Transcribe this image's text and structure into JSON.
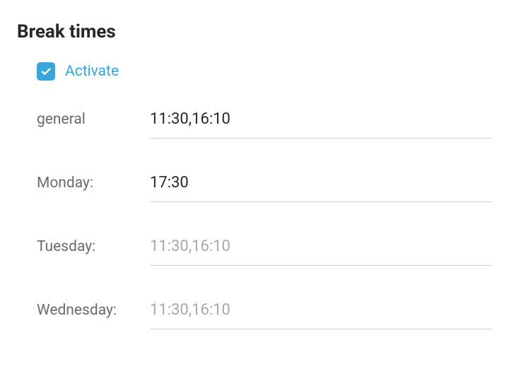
{
  "section": {
    "title": "Break times"
  },
  "activate": {
    "label": "Activate",
    "checked": true
  },
  "fields": {
    "general": {
      "label": "general",
      "value": "11:30,16:10",
      "placeholder": ""
    },
    "monday": {
      "label": "Monday:",
      "value": "17:30",
      "placeholder": ""
    },
    "tuesday": {
      "label": "Tuesday:",
      "value": "",
      "placeholder": "11:30,16:10"
    },
    "wednesday": {
      "label": "Wednesday:",
      "value": "",
      "placeholder": "11:30,16:10"
    }
  }
}
